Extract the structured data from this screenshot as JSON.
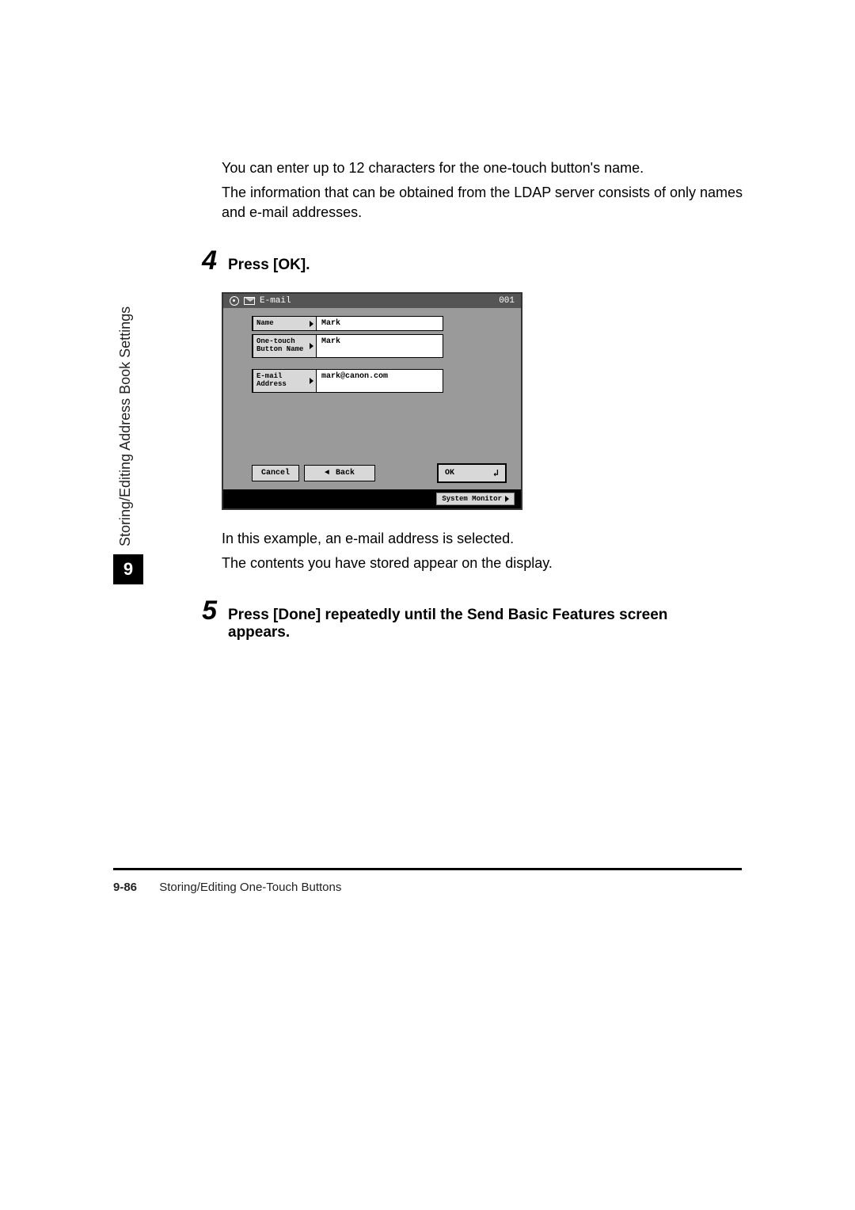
{
  "sidebar": {
    "chapter_number": "9",
    "chapter_title": "Storing/Editing Address Book Settings"
  },
  "body": {
    "para1": "You can enter up to 12 characters for the one-touch button's name.",
    "para2": "The information that can be obtained from the LDAP server consists of only names and e-mail addresses."
  },
  "step4": {
    "number": "4",
    "title": "Press [OK]."
  },
  "screenshot": {
    "header": {
      "title": "E-mail",
      "id": "001"
    },
    "rows": {
      "name": {
        "label": "Name",
        "value": "Mark"
      },
      "onetouch": {
        "label": "One-touch\nButton Name",
        "value": "Mark"
      },
      "email": {
        "label": "E-mail\nAddress",
        "value": "mark@canon.com"
      }
    },
    "buttons": {
      "cancel": "Cancel",
      "back": "Back",
      "ok": "OK",
      "system_monitor": "System Monitor"
    }
  },
  "below": {
    "line1": "In this example, an e-mail address is selected.",
    "line2": "The contents you have stored appear on the display."
  },
  "step5": {
    "number": "5",
    "title": "Press [Done] repeatedly until the Send Basic Features screen appears."
  },
  "footer": {
    "page_number": "9-86",
    "title": "Storing/Editing One-Touch Buttons"
  }
}
